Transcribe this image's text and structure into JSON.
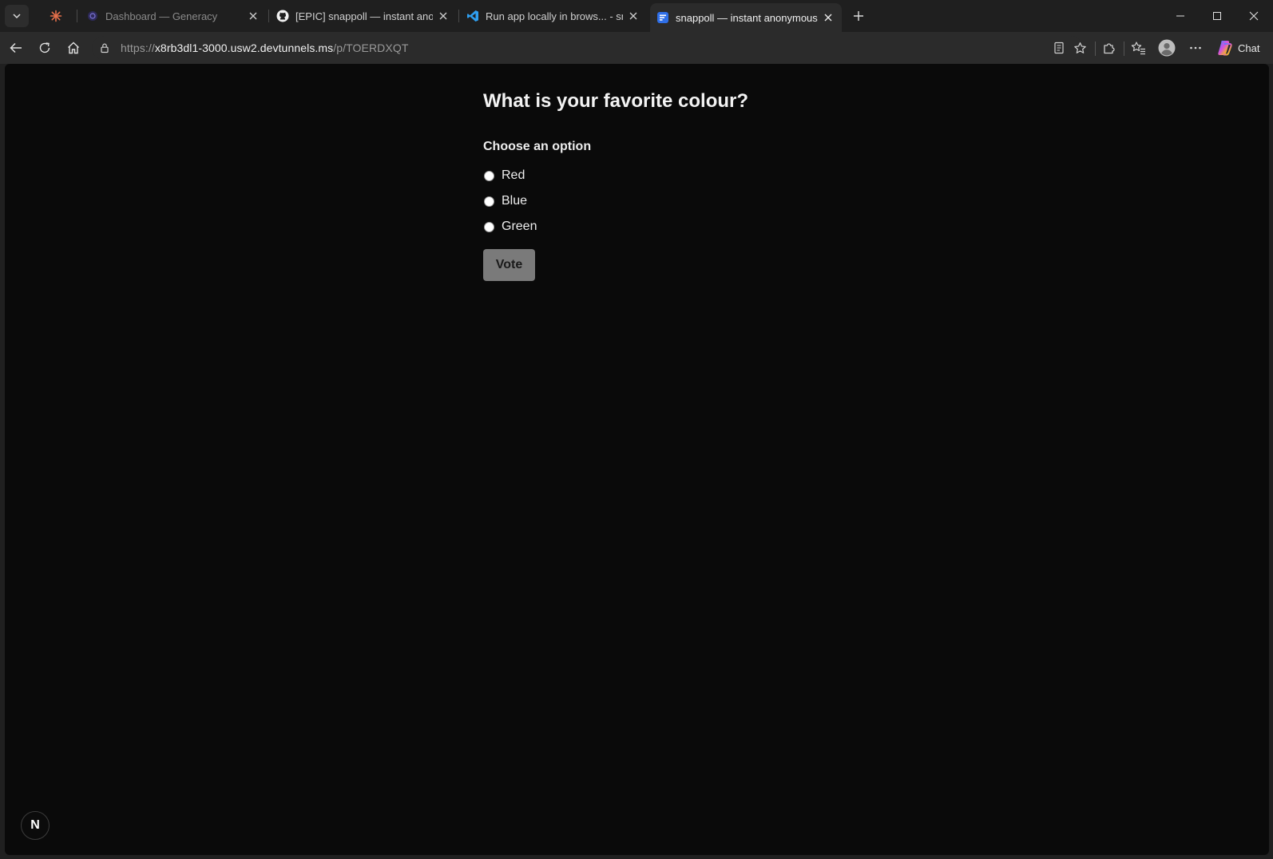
{
  "browser": {
    "tabs": [
      {
        "title": "Dashboard — Generacy",
        "favicon": "generacy-icon",
        "state": "inactive"
      },
      {
        "title": "[EPIC] snappoll — instant anonymous",
        "favicon": "github-icon",
        "state": "inactive"
      },
      {
        "title": "Run app locally in brows... - snappoll",
        "favicon": "vscode-icon",
        "state": "inactive"
      },
      {
        "title": "snappoll — instant anonymous poll",
        "favicon": "snappoll-icon",
        "state": "active"
      }
    ],
    "address": {
      "scheme": "https://",
      "host": "x8rb3dl1-3000.usw2.devtunnels.ms",
      "path": "/p/TOERDXQT"
    },
    "copilot_label": "Chat",
    "colors": {
      "copilot_gradient": [
        "#3b8cff",
        "#d44fe0",
        "#f5b12b",
        "#22c55e"
      ]
    }
  },
  "page": {
    "question": "What is your favorite colour?",
    "choose_label": "Choose an option",
    "options": [
      "Red",
      "Blue",
      "Green"
    ],
    "vote_label": "Vote",
    "dev_badge": "N"
  }
}
